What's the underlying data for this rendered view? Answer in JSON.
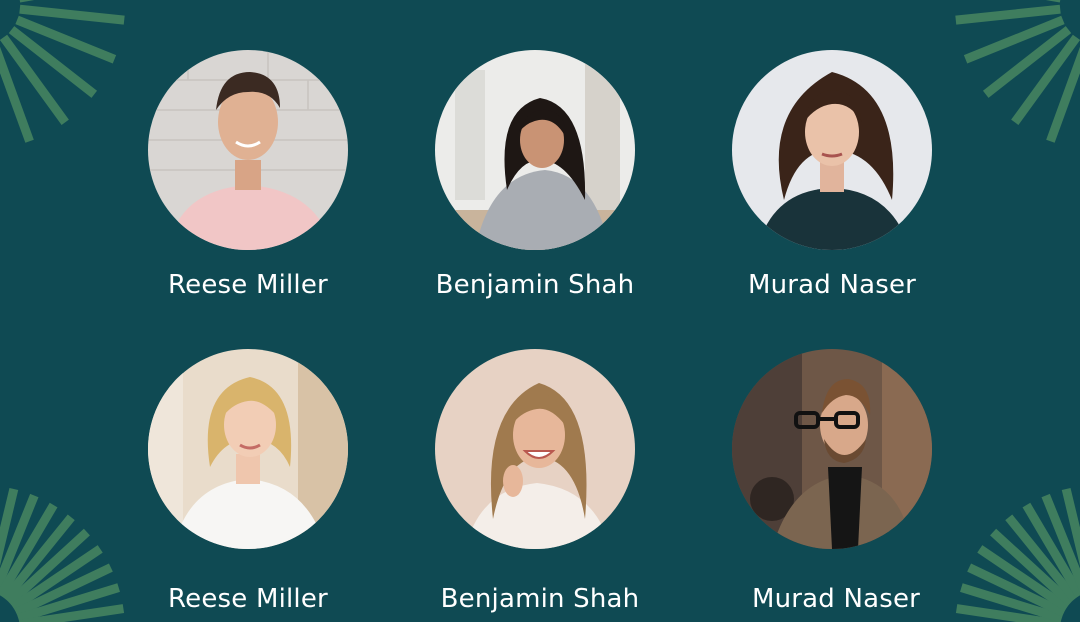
{
  "colors": {
    "background": "#0f4a53",
    "accent": "#3f7d5e",
    "text": "#ffffff"
  },
  "team": [
    {
      "name": "Reese Miller",
      "photo": "man-pink-shirt-brick-wall"
    },
    {
      "name": "Benjamin Shah",
      "photo": "woman-grey-sweater-laptop"
    },
    {
      "name": "Murad Naser",
      "photo": "woman-curly-hair-dark-top"
    },
    {
      "name": "Reese Miller",
      "photo": "woman-blonde-white-blouse"
    },
    {
      "name": "Benjamin Shah",
      "photo": "woman-wavy-hair-laughing"
    },
    {
      "name": "Murad Naser",
      "photo": "man-glasses-beard-city"
    }
  ],
  "decorations": [
    "sunburst-icon",
    "sunburst-icon",
    "sunburst-icon",
    "sunburst-icon"
  ]
}
